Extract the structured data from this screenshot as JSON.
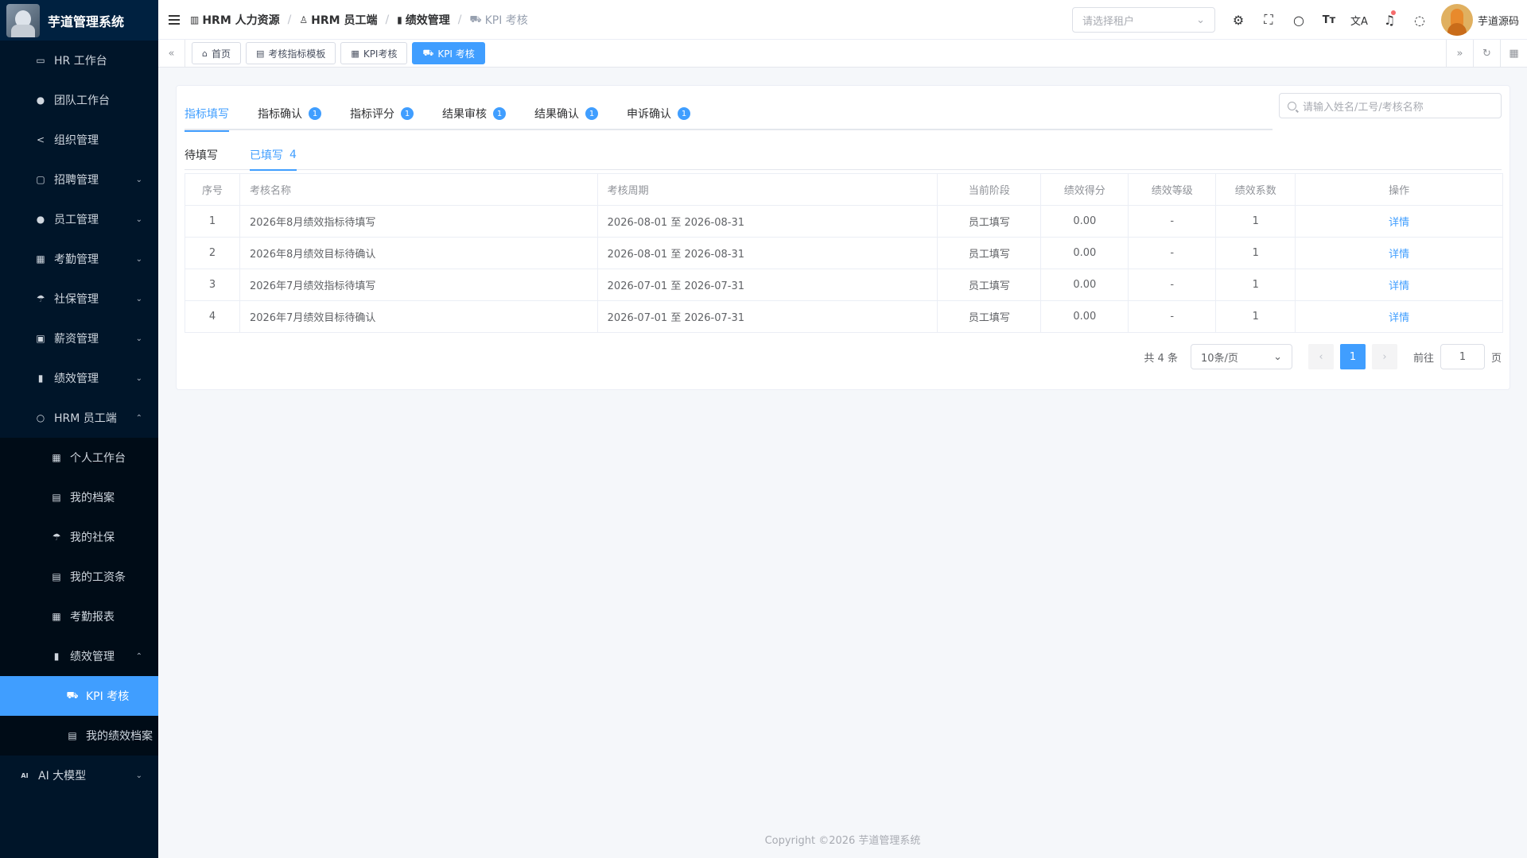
{
  "app": {
    "title": "芋道管理系统"
  },
  "sidebar": {
    "items": [
      {
        "label": "HR 工作台",
        "icon": "desktop-icon",
        "glyph": "▭"
      },
      {
        "label": "团队工作台",
        "icon": "user-icon",
        "glyph": "●"
      },
      {
        "label": "组织管理",
        "icon": "share-icon",
        "glyph": "<"
      },
      {
        "label": "招聘管理",
        "icon": "briefcase-icon",
        "glyph": "▢",
        "chevron": "⌄"
      },
      {
        "label": "员工管理",
        "icon": "user-icon",
        "glyph": "●",
        "chevron": "⌄"
      },
      {
        "label": "考勤管理",
        "icon": "calendar-icon",
        "glyph": "▦",
        "chevron": "⌄"
      },
      {
        "label": "社保管理",
        "icon": "umbrella-icon",
        "glyph": "☂",
        "chevron": "⌄"
      },
      {
        "label": "薪资管理",
        "icon": "money-icon",
        "glyph": "▣",
        "chevron": "⌄"
      },
      {
        "label": "绩效管理",
        "icon": "bar-chart-icon",
        "glyph": "▮",
        "chevron": "⌄"
      },
      {
        "label": "HRM 员工端",
        "icon": "user-outline-icon",
        "glyph": "○",
        "chevron": "⌃"
      }
    ],
    "sub_items": [
      {
        "label": "个人工作台",
        "icon": "calendar-icon",
        "glyph": "▦"
      },
      {
        "label": "我的档案",
        "icon": "book-icon",
        "glyph": "▤"
      },
      {
        "label": "我的社保",
        "icon": "umbrella-icon",
        "glyph": "☂"
      },
      {
        "label": "我的工资条",
        "icon": "document-icon",
        "glyph": "▤"
      },
      {
        "label": "考勤报表",
        "icon": "calendar-icon",
        "glyph": "▦"
      },
      {
        "label": "绩效管理",
        "icon": "bar-chart-icon",
        "glyph": "▮",
        "chevron": "⌃"
      }
    ],
    "sub2_items": [
      {
        "label": "KPI 考核",
        "icon": "cart-icon",
        "glyph": "⛟",
        "active": true
      },
      {
        "label": "我的绩效档案",
        "icon": "book-icon",
        "glyph": "▤"
      }
    ],
    "bottom_item": {
      "label": "AI 大模型",
      "icon": "ai-icon",
      "glyph": "AI",
      "chevron": "⌄"
    }
  },
  "header": {
    "breadcrumb": [
      {
        "label": "HRM 人力资源",
        "icon": "building-icon",
        "glyph": "▥"
      },
      {
        "label": "HRM 员工端",
        "icon": "user-outline-icon",
        "glyph": "♙"
      },
      {
        "label": "绩效管理",
        "icon": "bar-chart-icon",
        "glyph": "▮"
      },
      {
        "label": "KPI 考核",
        "icon": "cart-icon",
        "glyph": "⛟"
      }
    ],
    "tenant_placeholder": "请选择租户",
    "user_name": "芋道源码"
  },
  "tags": [
    {
      "label": "首页",
      "icon": "home-icon",
      "glyph": "⌂"
    },
    {
      "label": "考核指标模板",
      "icon": "document-icon",
      "glyph": "▤"
    },
    {
      "label": "KPI考核",
      "icon": "calendar-icon",
      "glyph": "▦"
    },
    {
      "label": "KPI 考核",
      "icon": "cart-icon",
      "glyph": "⛟",
      "active": true
    }
  ],
  "tabs": [
    {
      "label": "指标填写",
      "badge": "",
      "active": true
    },
    {
      "label": "指标确认",
      "badge": "1"
    },
    {
      "label": "指标评分",
      "badge": "1"
    },
    {
      "label": "结果审核",
      "badge": "1"
    },
    {
      "label": "结果确认",
      "badge": "1"
    },
    {
      "label": "申诉确认",
      "badge": "1"
    }
  ],
  "search": {
    "placeholder": "请输入姓名/工号/考核名称"
  },
  "subtabs": [
    {
      "label": "待填写",
      "count": ""
    },
    {
      "label": "已填写",
      "count": "4",
      "active": true
    }
  ],
  "table": {
    "columns": [
      "序号",
      "考核名称",
      "考核周期",
      "当前阶段",
      "绩效得分",
      "绩效等级",
      "绩效系数",
      "操作"
    ],
    "rows": [
      [
        "1",
        "2026年8月绩效指标待填写",
        "2026-08-01 至 2026-08-31",
        "员工填写",
        "0.00",
        "-",
        "1",
        "详情"
      ],
      [
        "2",
        "2026年8月绩效目标待确认",
        "2026-08-01 至 2026-08-31",
        "员工填写",
        "0.00",
        "-",
        "1",
        "详情"
      ],
      [
        "3",
        "2026年7月绩效指标待填写",
        "2026-07-01 至 2026-07-31",
        "员工填写",
        "0.00",
        "-",
        "1",
        "详情"
      ],
      [
        "4",
        "2026年7月绩效目标待确认",
        "2026-07-01 至 2026-07-31",
        "员工填写",
        "0.00",
        "-",
        "1",
        "详情"
      ]
    ]
  },
  "pagination": {
    "total": "共 4 条",
    "page_size": "10条/页",
    "current_page": "1",
    "goto_label": "前往",
    "goto_value": "1",
    "page_suffix": "页"
  },
  "footer": {
    "text": "Copyright ©2026 芋道管理系统"
  },
  "colors": {
    "primary": "#409eff",
    "sidebar_bg": "#001529",
    "badge_dot": "#f56c6c"
  }
}
